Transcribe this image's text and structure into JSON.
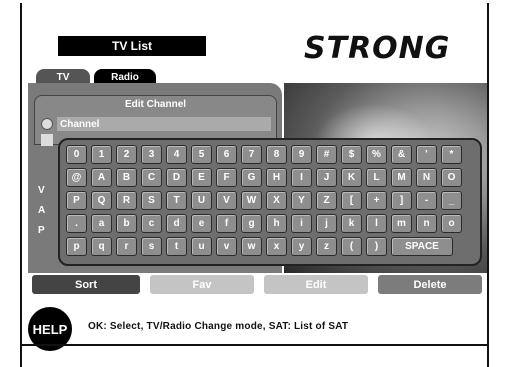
{
  "header": {
    "title": "TV List",
    "brand": "STRONG"
  },
  "tabs": [
    {
      "label": "TV"
    },
    {
      "label": "Radio"
    }
  ],
  "edit_dialog": {
    "title": "Edit Channel",
    "field_value": "Channel"
  },
  "side_labels": [
    "V",
    "A",
    "P"
  ],
  "keyboard": {
    "rows": [
      [
        "0",
        "1",
        "2",
        "3",
        "4",
        "5",
        "6",
        "7",
        "8",
        "9",
        "#",
        "$",
        "%",
        "&",
        "'",
        "*"
      ],
      [
        "@",
        "A",
        "B",
        "C",
        "D",
        "E",
        "F",
        "G",
        "H",
        "I",
        "J",
        "K",
        "L",
        "M",
        "N",
        "O"
      ],
      [
        "P",
        "Q",
        "R",
        "S",
        "T",
        "U",
        "V",
        "W",
        "X",
        "Y",
        "Z",
        "[",
        "+",
        "]",
        "-",
        "_"
      ],
      [
        ".",
        "a",
        "b",
        "c",
        "d",
        "e",
        "f",
        "g",
        "h",
        "i",
        "j",
        "k",
        "l",
        "m",
        "n",
        "o"
      ],
      [
        "p",
        "q",
        "r",
        "s",
        "t",
        "u",
        "v",
        "w",
        "x",
        "y",
        "z",
        "(",
        ")",
        "SPACE"
      ]
    ]
  },
  "buttons": {
    "sort": "Sort",
    "fav": "Fav",
    "edit": "Edit",
    "delete": "Delete"
  },
  "help": {
    "badge": "HELP",
    "text": "OK: Select, TV/Radio Change mode, SAT: List of SAT"
  }
}
